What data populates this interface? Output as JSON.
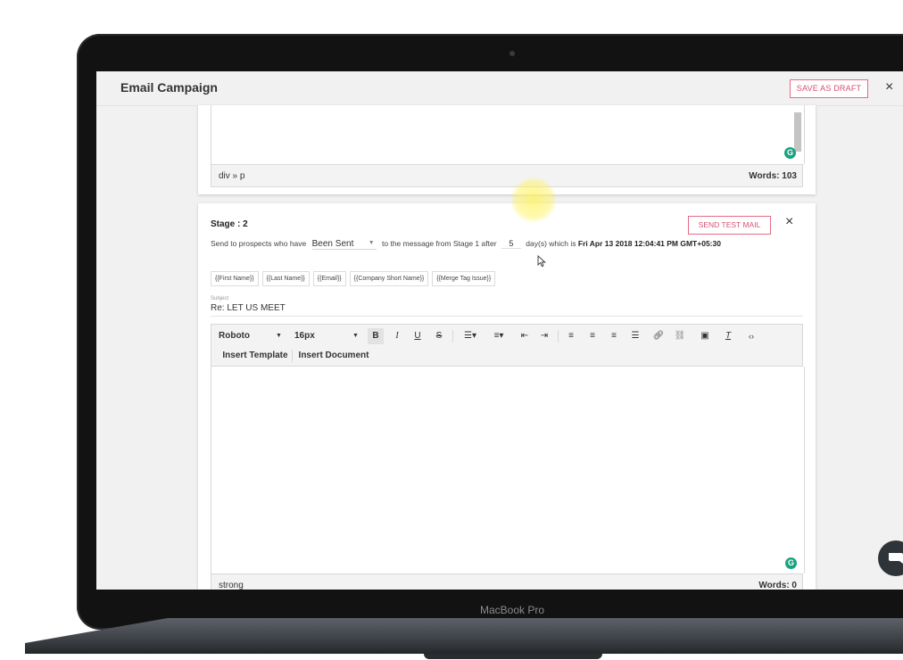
{
  "header": {
    "title": "Email Campaign",
    "save_draft": "SAVE AS DRAFT",
    "close": "×"
  },
  "stage1": {
    "element_path": "div » p",
    "word_count": "Words: 103"
  },
  "stage2": {
    "title": "Stage : 2",
    "send_test": "SEND TEST MAIL",
    "close": "×",
    "sentence_prefix": "Send to prospects who have",
    "status_value": "Been Sent",
    "sentence_middle": "to the message from Stage 1 after",
    "days": "5",
    "sentence_suffix": "day(s) which is",
    "scheduled_date": "Fri Apr 13 2018 12:04:41 PM GMT+05:30",
    "merge_tags": [
      "{{First Name}}",
      "{{Last Name}}",
      "{{Email}}",
      "{{Company Short Name}}",
      "{{Merge Tag Issue}}"
    ],
    "subject_label": "Subject",
    "subject_value": "Re: LET US MEET",
    "toolbar": {
      "font": "Roboto",
      "size": "16px",
      "insert_template": "Insert Template",
      "insert_document": "Insert Document"
    },
    "element_path": "strong",
    "word_count": "Words: 0"
  },
  "laptop": {
    "label": "MacBook Pro"
  },
  "icons": {
    "grammarly": "grammarly-icon",
    "chat": "chat-bubble-icon"
  }
}
